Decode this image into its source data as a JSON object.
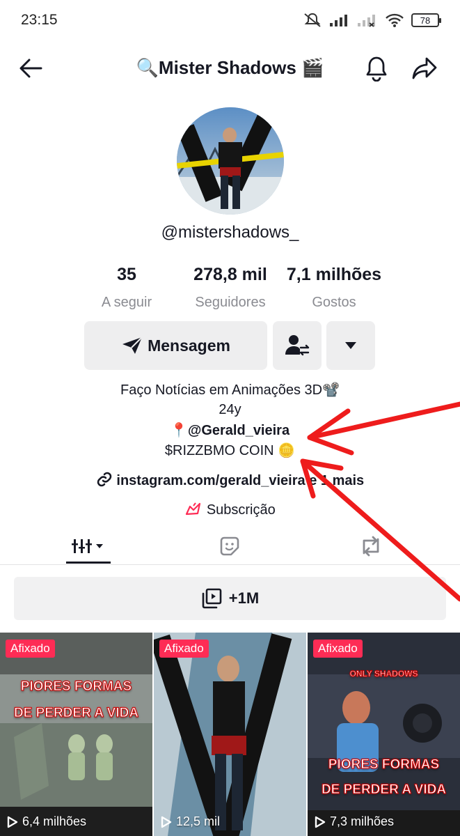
{
  "status_bar": {
    "time": "23:15",
    "battery": "78"
  },
  "header": {
    "title": "🔍Mister Shadows 🎬"
  },
  "profile": {
    "username": "@mistershadows_",
    "stats": [
      {
        "value": "35",
        "label": "A seguir"
      },
      {
        "value": "278,8 mil",
        "label": "Seguidores"
      },
      {
        "value": "7,1 milhões",
        "label": "Gostos"
      }
    ],
    "message_label": "Mensagem",
    "bio": {
      "line1": "Faço Notícias em Animações 3D📽️",
      "line2": "24y",
      "pin_emoji": "📍",
      "mention": "@Gerald_vieira",
      "coin": "$RIZZBMO COIN 🪙"
    },
    "link": {
      "text": "instagram.com/gerald_vieira",
      "more": "e 1 mais"
    },
    "subscription_label": "Subscrição"
  },
  "playlist": {
    "label": "+1M"
  },
  "videos": [
    {
      "badge": "Afixado",
      "title_line1": "PIORES FORMAS",
      "title_line2": "DE PERDER  A VIDA",
      "views": "6,4 milhões"
    },
    {
      "badge": "Afixado",
      "views": "12,5 mil"
    },
    {
      "badge": "Afixado",
      "logo": "ONLY SHADOWS",
      "title_line1": "PIORES FORMAS",
      "title_line2": "DE PERDER  A VIDA",
      "views": "7,3 milhões"
    }
  ],
  "colors": {
    "accent": "#fe2c55",
    "annotation": "#ee1c1c"
  }
}
